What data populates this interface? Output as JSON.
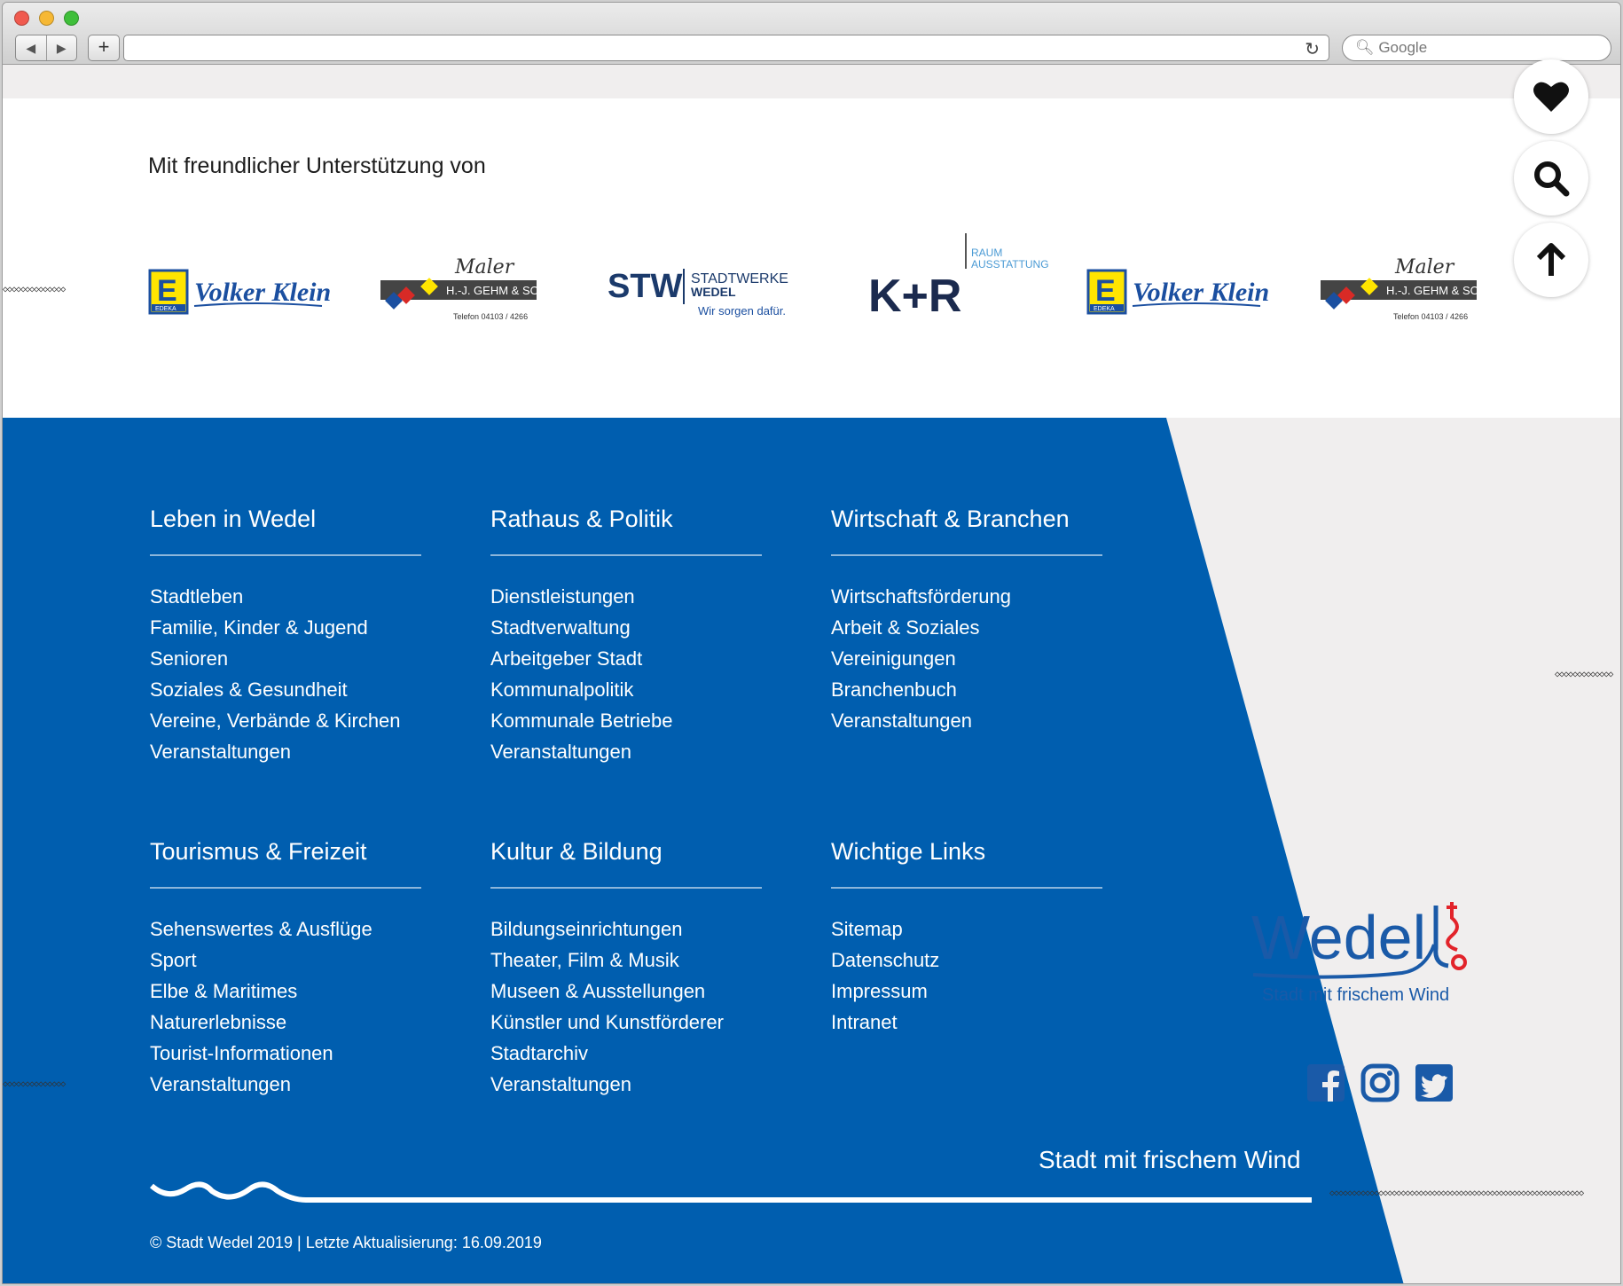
{
  "browser": {
    "search_placeholder": "Google"
  },
  "sponsors": {
    "title": "Mit freundlicher Unterstützung von",
    "logos": [
      {
        "name": "Volker Klein",
        "tag": "EDEKA"
      },
      {
        "name": "H.-J. GEHM & SOHN",
        "line": "Maler",
        "phone": "Telefon 04103 / 4266"
      },
      {
        "name": "STW",
        "subtitle": "STADTWERKE",
        "subtitle2": "WEDEL",
        "slogan": "Wir sorgen dafür."
      },
      {
        "name": "K+R",
        "subtitle": "RAUM",
        "subtitle2": "AUSSTATTUNG"
      },
      {
        "name": "Volker Klein",
        "tag": "EDEKA"
      },
      {
        "name": "H.-J. GEHM & SOHN",
        "line": "Maler",
        "phone": "Telefon 04103 / 4266"
      }
    ]
  },
  "footer": {
    "columns": [
      {
        "title": "Leben in Wedel",
        "links": [
          "Stadtleben",
          "Familie, Kinder & Jugend",
          "Senioren",
          "Soziales & Gesundheit",
          "Vereine, Verbände & Kirchen",
          "Veranstaltungen"
        ]
      },
      {
        "title": "Rathaus & Politik",
        "links": [
          "Dienstleistungen",
          "Stadtverwaltung",
          "Arbeitgeber Stadt",
          "Kommunalpolitik",
          "Kommunale Betriebe",
          "Veranstaltungen"
        ]
      },
      {
        "title": "Wirtschaft & Branchen",
        "links": [
          "Wirtschaftsförderung",
          "Arbeit & Soziales",
          "Vereinigungen",
          "Branchenbuch",
          "Veranstaltungen"
        ]
      },
      {
        "title": "Tourismus & Freizeit",
        "links": [
          "Sehenswertes & Ausflüge",
          "Sport",
          "Elbe & Maritimes",
          "Naturerlebnisse",
          "Tourist-Informationen",
          "Veranstaltungen"
        ]
      },
      {
        "title": "Kultur & Bildung",
        "links": [
          "Bildungseinrichtungen",
          "Theater, Film & Musik",
          "Museen & Ausstellungen",
          "Künstler und Kunstförderer",
          "Stadtarchiv",
          "Veranstaltungen"
        ]
      },
      {
        "title": "Wichtige Links",
        "links": [
          "Sitemap",
          "Datenschutz",
          "Impressum",
          "Intranet"
        ]
      }
    ],
    "slogan": "Stadt mit frischem Wind",
    "copyright": "© Stadt Wedel 2019   |   Letzte Aktualisierung: 16.09.2019",
    "brand": {
      "name": "Wedel",
      "tagline": "Stadt mit frischem Wind"
    },
    "social": [
      "facebook-icon",
      "instagram-icon",
      "twitter-icon"
    ]
  },
  "colors": {
    "brand_blue": "#005eaf",
    "accent_red": "#e2232a",
    "background_gray": "#f0eeee"
  }
}
